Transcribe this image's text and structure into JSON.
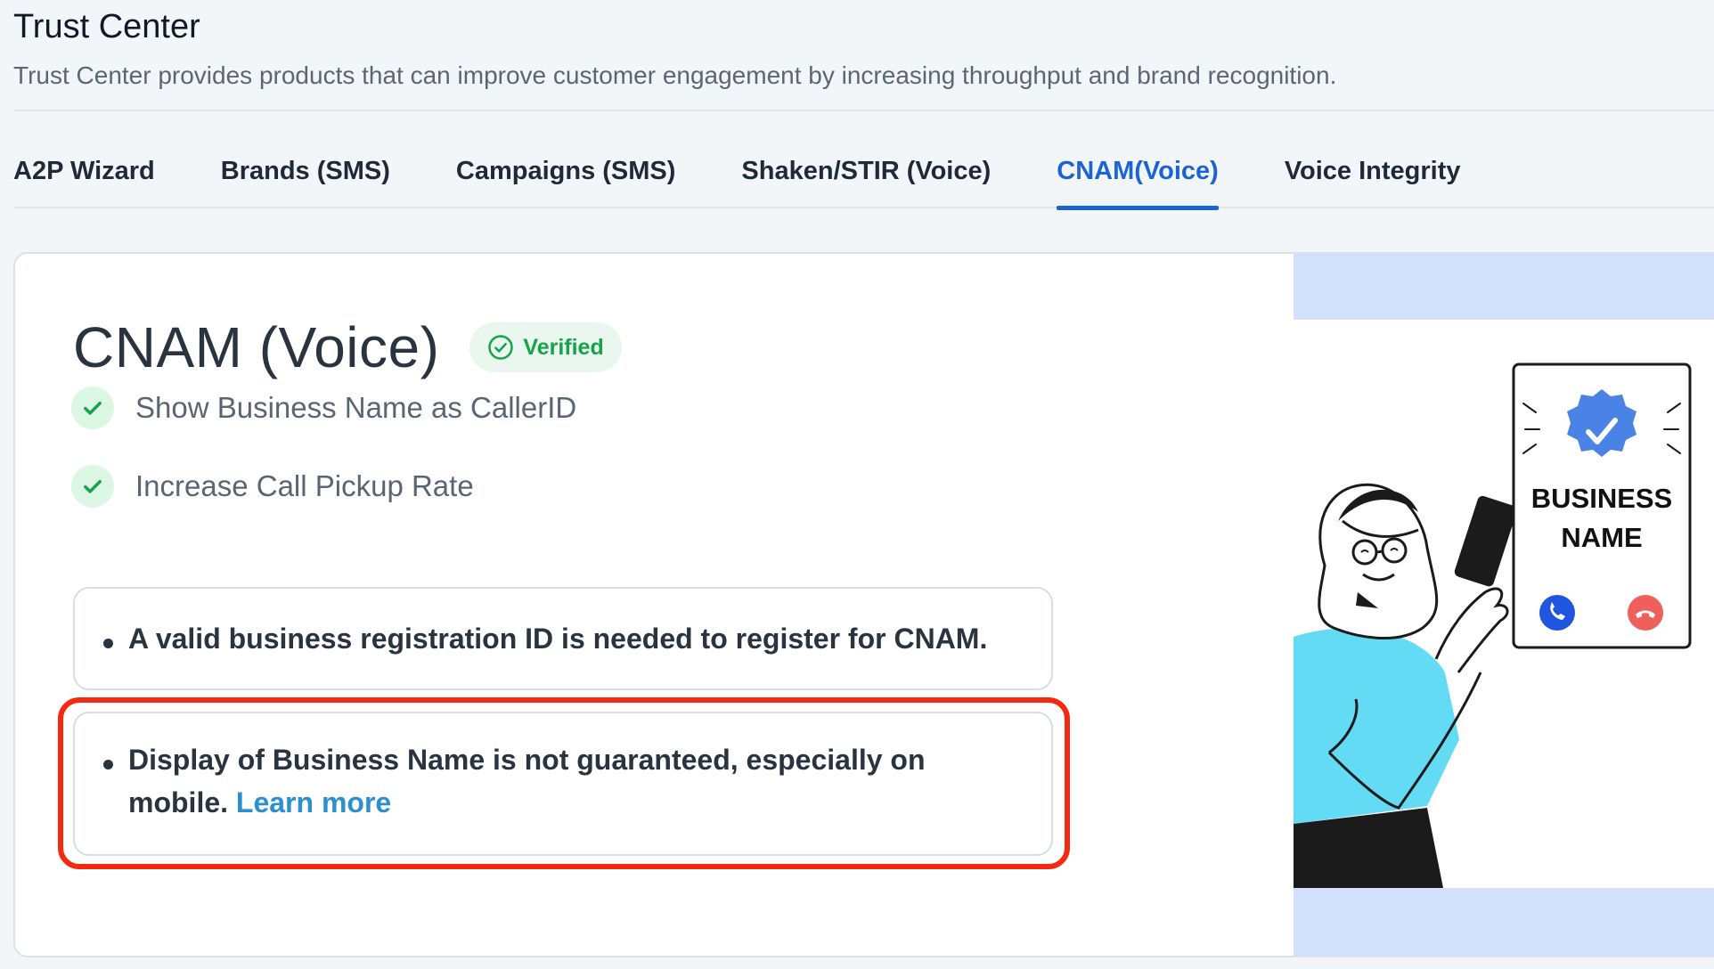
{
  "header": {
    "title": "Trust Center",
    "subtitle": "Trust Center provides products that can improve customer engagement by increasing throughput and brand recognition."
  },
  "tabs": [
    {
      "label": "A2P Wizard",
      "active": false
    },
    {
      "label": "Brands (SMS)",
      "active": false
    },
    {
      "label": "Campaigns (SMS)",
      "active": false
    },
    {
      "label": "Shaken/STIR (Voice)",
      "active": false
    },
    {
      "label": "CNAM(Voice)",
      "active": true
    },
    {
      "label": "Voice Integrity",
      "active": false
    }
  ],
  "card": {
    "title": "CNAM (Voice)",
    "badge": {
      "label": "Verified",
      "icon": "check-circle-icon"
    },
    "features": [
      {
        "label": "Show Business Name as CallerID",
        "icon": "check-icon"
      },
      {
        "label": "Increase Call Pickup Rate",
        "icon": "check-icon"
      }
    ],
    "notes": [
      {
        "text": "A valid business registration ID is needed to register for CNAM."
      },
      {
        "text": "Display of Business Name is not guaranteed, especially on mobile.",
        "link": "Learn more"
      }
    ]
  },
  "illustration": {
    "line1": "BUSINESS",
    "line2": "NAME",
    "icons": [
      "verified-badge-icon",
      "accept-call-icon",
      "decline-call-icon"
    ]
  },
  "colors": {
    "accent": "#1c64d6",
    "verified_green": "#17a34a",
    "link": "#2b8fd0",
    "highlight": "#f4290f"
  }
}
